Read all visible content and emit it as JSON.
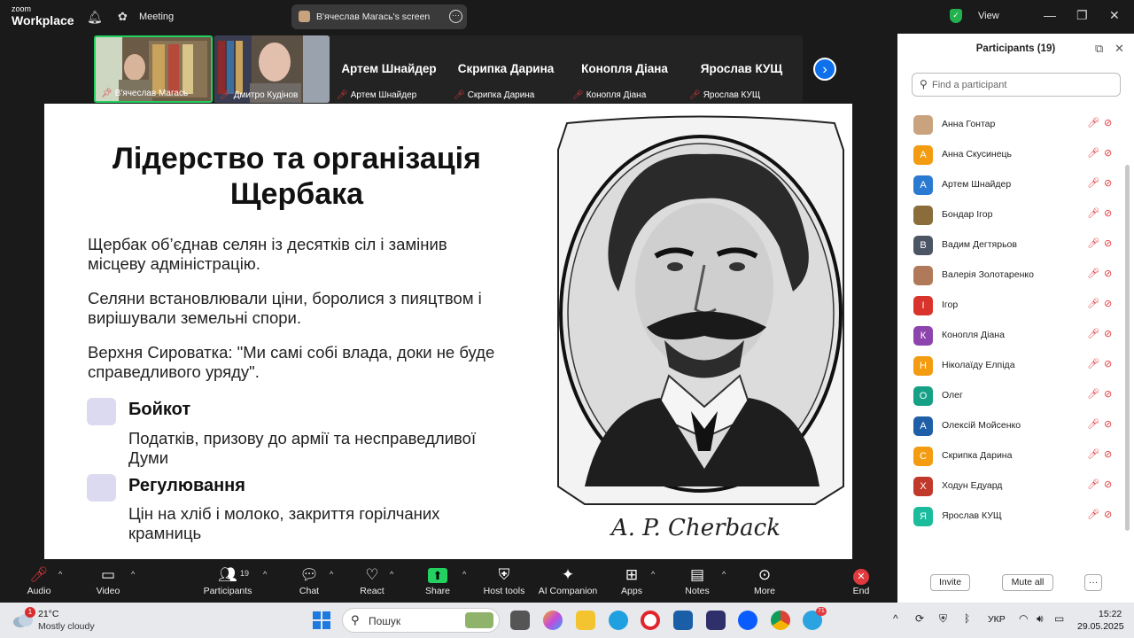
{
  "titlebar": {
    "logo_line1": "zoom",
    "logo_line2": "Workplace",
    "meeting_label": "Meeting",
    "share_label": "В'ячеслав Магась's screen",
    "view_label": "View"
  },
  "strip": {
    "tiles": [
      {
        "label": "В'ячеслав Магась",
        "kind": "video"
      },
      {
        "label": "Дмитро Кудінов",
        "kind": "video"
      },
      {
        "big": "Артем Шнайдер",
        "label": "Артем Шнайдер",
        "kind": "name"
      },
      {
        "big": "Скрипка Дарина",
        "label": "Скрипка Дарина",
        "kind": "name"
      },
      {
        "big": "Конопля Діана",
        "label": "Конопля Діана",
        "kind": "name"
      },
      {
        "big": "Ярослав КУЩ",
        "label": "Ярослав КУЩ",
        "kind": "name"
      }
    ]
  },
  "slide": {
    "title": "Лідерство та організація Щербака",
    "para1": "Щербак об’єднав селян із десятків сіл і замінив місцеву адміністрацію.",
    "para2": "Селяни встановлювали ціни, боролися з пияцтвом і вирішували земельні спори.",
    "para3": "Верхня Сироватка: \"Ми самі собі влада, доки не буде справедливого уряду\".",
    "item1_title": "Бойкот",
    "item1_desc": "Податків, призову до армії та несправедливої Думи",
    "item2_title": "Регулювання",
    "item2_desc": "Цін на хліб і молоко, закриття горілчаних крамниць",
    "signature": "A. P. Cherback"
  },
  "panel": {
    "title": "Participants (19)",
    "search_placeholder": "Find a participant",
    "participants": [
      {
        "name": "Анна Гонтар",
        "initial": "",
        "color": "#c9a37d",
        "photo": true
      },
      {
        "name": "Анна Скусинець",
        "initial": "А",
        "color": "#f39c12"
      },
      {
        "name": "Артем Шнайдер",
        "initial": "А",
        "color": "#2a7ad1"
      },
      {
        "name": "Бондар Ігор",
        "initial": "",
        "color": "#8a6d3b",
        "photo": true
      },
      {
        "name": "Вадим Дегтярьов",
        "initial": "В",
        "color": "#4b5563"
      },
      {
        "name": "Валерія Золотаренко",
        "initial": "",
        "color": "#b07a5a",
        "photo": true
      },
      {
        "name": "Ігор",
        "initial": "І",
        "color": "#d9342b"
      },
      {
        "name": "Конопля Діана",
        "initial": "К",
        "color": "#8e44ad"
      },
      {
        "name": "Ніколаїду Елпіда",
        "initial": "Н",
        "color": "#f39c12"
      },
      {
        "name": "Олег",
        "initial": "О",
        "color": "#16a085"
      },
      {
        "name": "Олексій Мойсенко",
        "initial": "А",
        "color": "#1f5fa8"
      },
      {
        "name": "Скрипка Дарина",
        "initial": "С",
        "color": "#f39c12"
      },
      {
        "name": "Ходун Едуард",
        "initial": "Х",
        "color": "#c0392b"
      },
      {
        "name": "Ярослав КУЩ",
        "initial": "Я",
        "color": "#1abc9c"
      }
    ],
    "invite_label": "Invite",
    "mute_all_label": "Mute all",
    "more_label": "···"
  },
  "toolbar": {
    "audio": "Audio",
    "video": "Video",
    "participants": "Participants",
    "participants_count": "19",
    "chat": "Chat",
    "react": "React",
    "share": "Share",
    "host_tools": "Host tools",
    "ai": "AI Companion",
    "apps": "Apps",
    "notes": "Notes",
    "more": "More",
    "end": "End"
  },
  "taskbar": {
    "weather_badge": "1",
    "temp": "21°C",
    "weather": "Mostly cloudy",
    "search": "Пошук",
    "lang": "УКР",
    "time": "15:22",
    "date": "29.05.2025",
    "telegram_badge": "71"
  }
}
